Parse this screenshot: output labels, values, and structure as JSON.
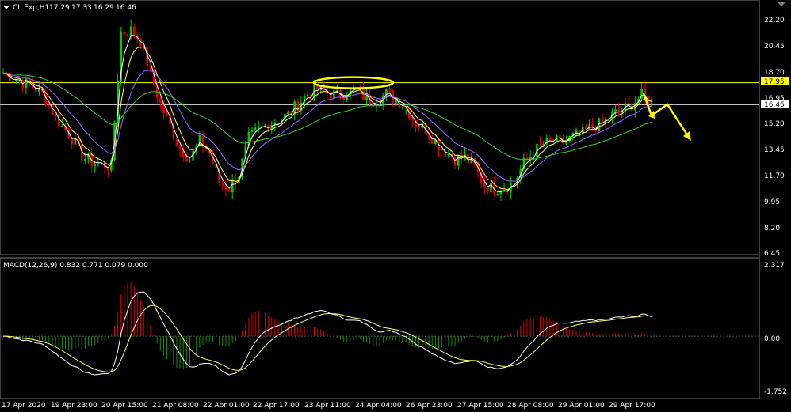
{
  "chart_data": {
    "type": "candlestick",
    "title": "CL.Exp,H1",
    "ohlc": {
      "open": "17.29",
      "high": "17.33",
      "low": "16.29",
      "close": "16.46"
    },
    "price_axis": {
      "ticks": [
        "22.20",
        "20.45",
        "18.70",
        "16.95",
        "15.20",
        "13.45",
        "11.70",
        "9.95",
        "8.20",
        "6.45"
      ],
      "ylim": [
        6.45,
        22.9
      ],
      "markers": [
        {
          "label": "17.95",
          "value": 17.95,
          "color": "#ffff00"
        },
        {
          "label": "16.46",
          "value": 16.46,
          "color": "#c8c8c8"
        }
      ]
    },
    "x_ticks": [
      "17 Apr 2020",
      "19 Apr 23:00",
      "20 Apr 15:00",
      "21 Apr 08:00",
      "22 Apr 01:00",
      "22 Apr 17:00",
      "23 Apr 11:00",
      "24 Apr 04:00",
      "26 Apr 23:00",
      "27 Apr 15:00",
      "28 Apr 08:00",
      "29 Apr 01:00",
      "29 Apr 17:00"
    ],
    "price_path": [
      18.6,
      18.3,
      18.0,
      17.7,
      17.2,
      16.0,
      15.0,
      14.2,
      13.0,
      12.6,
      12.4,
      12.3,
      21.3,
      21.5,
      20.8,
      18.5,
      16.5,
      15.0,
      13.5,
      12.8,
      14.0,
      13.2,
      11.2,
      10.8,
      11.8,
      14.2,
      14.8,
      15.2,
      15.4,
      15.8,
      16.5,
      17.2,
      17.5,
      17.3,
      17.1,
      17.3,
      17.5,
      16.8,
      16.8,
      17.2,
      16.8,
      16.3,
      15.2,
      14.8,
      14.0,
      13.3,
      12.8,
      12.9,
      12.2,
      11.0,
      10.8,
      10.9,
      11.2,
      12.5,
      13.3,
      13.8,
      14.0,
      13.9,
      14.3,
      14.5,
      15.0,
      15.2,
      15.8,
      16.1,
      16.5,
      17.1,
      16.6
    ],
    "overlays": [
      {
        "color": "#ffffff",
        "period": 3
      },
      {
        "color": "#ffff66",
        "period": 6
      },
      {
        "color": "#9966ff",
        "period": 14
      },
      {
        "color": "#33cc33",
        "period": 40
      }
    ],
    "horizontal_line": {
      "value": 17.95,
      "color": "#ffff00"
    },
    "highlight_ellipse": {
      "value": 17.95,
      "color": "#ffff00"
    },
    "forecast_arrows": {
      "color": "#ffff00"
    },
    "macd": {
      "label": "MACD(12,26,9) 0.832 0.771 0.079 0.000",
      "ticks": [
        "2.317",
        "0.00",
        "-1.752"
      ],
      "ylim": [
        -1.752,
        2.317
      ]
    }
  }
}
